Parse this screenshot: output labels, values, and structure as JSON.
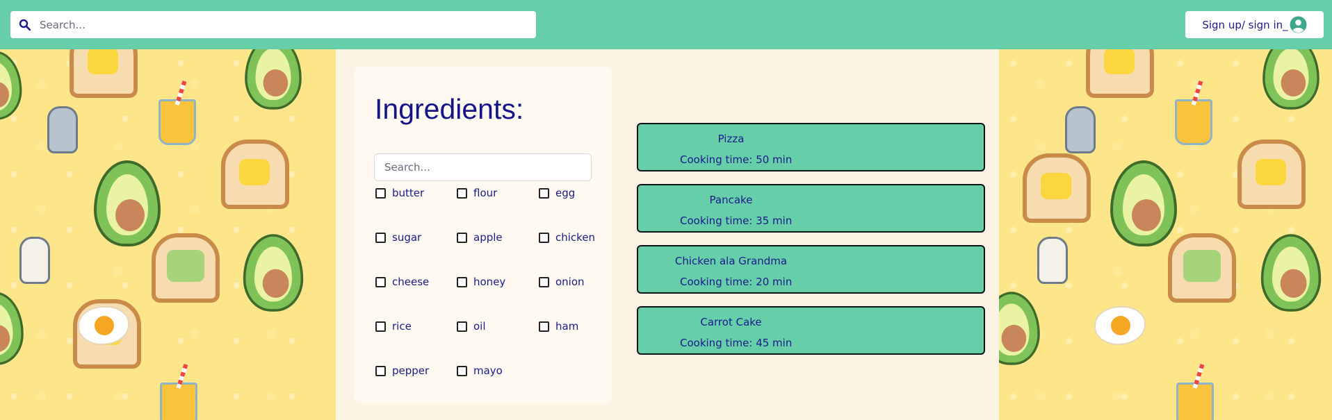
{
  "header": {
    "search_placeholder": "Search...",
    "sign_in_label": "Sign up/ sign in_"
  },
  "ingredients": {
    "title": "Ingredients:",
    "search_placeholder": "Search...",
    "items": [
      {
        "label": "butter"
      },
      {
        "label": "flour"
      },
      {
        "label": "egg"
      },
      {
        "label": "sugar"
      },
      {
        "label": "apple"
      },
      {
        "label": "chicken"
      },
      {
        "label": "cheese"
      },
      {
        "label": "honey"
      },
      {
        "label": "onion"
      },
      {
        "label": "rice"
      },
      {
        "label": "oil"
      },
      {
        "label": "ham"
      },
      {
        "label": "pepper"
      },
      {
        "label": "mayo"
      }
    ]
  },
  "recipes": [
    {
      "name": "Pizza",
      "time": "Cooking time: 50 min"
    },
    {
      "name": "Pancake",
      "time": "Cooking time: 35 min"
    },
    {
      "name": "Chicken ala Grandma",
      "time": "Cooking time: 20 min"
    },
    {
      "name": "Carrot Cake",
      "time": "Cooking time: 45 min"
    }
  ],
  "colors": {
    "header_bg": "#66cfa9",
    "card_bg": "#66cfa9",
    "text": "#1a1a8c",
    "main_bg": "#fdf3e4",
    "wallpaper": "#fde58a"
  },
  "icons": {
    "search": "search-icon",
    "user": "user-icon"
  }
}
